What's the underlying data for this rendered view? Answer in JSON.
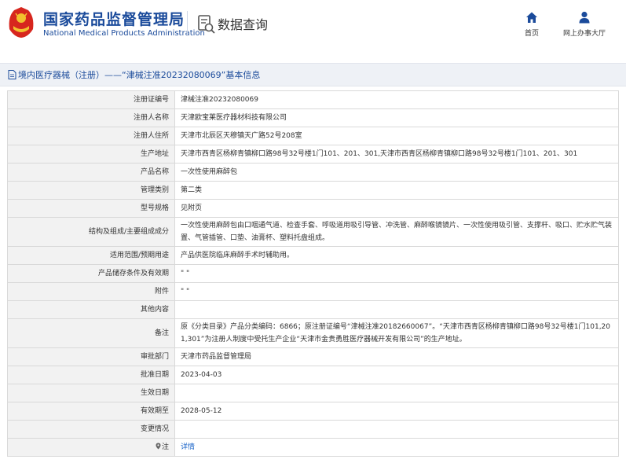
{
  "header": {
    "brand_cn": "国家药品监督管理局",
    "brand_en": "National Medical Products Administration",
    "query_label": "数据查询",
    "nav": [
      {
        "label": "首页",
        "icon": "home-icon"
      },
      {
        "label": "网上办事大厅",
        "icon": "user-icon"
      }
    ]
  },
  "colors": {
    "brand_blue": "#1b4b9b",
    "logo_red": "#d7261e",
    "logo_gold": "#f2c12e",
    "link_blue": "#1b65c9",
    "label_bg": "#f2f2f2",
    "band_bg": "#eef1f6"
  },
  "page_title": "境内医疗器械（注册）——“津械注准20232080069”基本信息",
  "rows": [
    {
      "label": "注册证编号",
      "value": "津械注准20232080069"
    },
    {
      "label": "注册人名称",
      "value": "天津欧宝莱医疗器材科技有限公司"
    },
    {
      "label": "注册人住所",
      "value": "天津市北辰区天穆镇天广路52号208室"
    },
    {
      "label": "生产地址",
      "value": "天津市西青区杨柳青镇柳口路98号32号楼1门101、201、301,天津市西青区杨柳青镇柳口路98号32号楼1门101、201、301"
    },
    {
      "label": "产品名称",
      "value": "一次性使用麻醉包"
    },
    {
      "label": "管理类别",
      "value": "第二类"
    },
    {
      "label": "型号规格",
      "value": "见附页"
    },
    {
      "label": "结构及组成/主要组成成分",
      "value": "一次性使用麻醉包由口咽通气道、检查手套、呼吸道用吸引导管、冲洗管、麻醉喉镜镜片、一次性使用吸引管、支撑杆、吸口、贮水贮气装置、气管插管、口垫、油膏杯、塑料托盘组成。"
    },
    {
      "label": "适用范围/预期用途",
      "value": "产品供医院临床麻醉手术时辅助用。"
    },
    {
      "label": "产品储存条件及有效期",
      "value": "\" \""
    },
    {
      "label": "附件",
      "value": "\" \""
    },
    {
      "label": "其他内容",
      "value": ""
    },
    {
      "label": "备注",
      "value": "原《分类目录》产品分类编码：6866；原注册证编号“津械注准20182660067”。“天津市西青区杨柳青镇柳口路98号32号楼1门101,201,301”为注册人制度中受托生产企业“天津市金贵勇胜医疗器械开发有限公司”的生产地址。"
    },
    {
      "label": "审批部门",
      "value": "天津市药品监督管理局"
    },
    {
      "label": "批准日期",
      "value": "2023-04-03"
    },
    {
      "label": "生效日期",
      "value": ""
    },
    {
      "label": "有效期至",
      "value": "2028-05-12"
    },
    {
      "label": "变更情况",
      "value": ""
    },
    {
      "label": "注",
      "value": "详情",
      "label_icon": "location-pin-icon"
    }
  ]
}
